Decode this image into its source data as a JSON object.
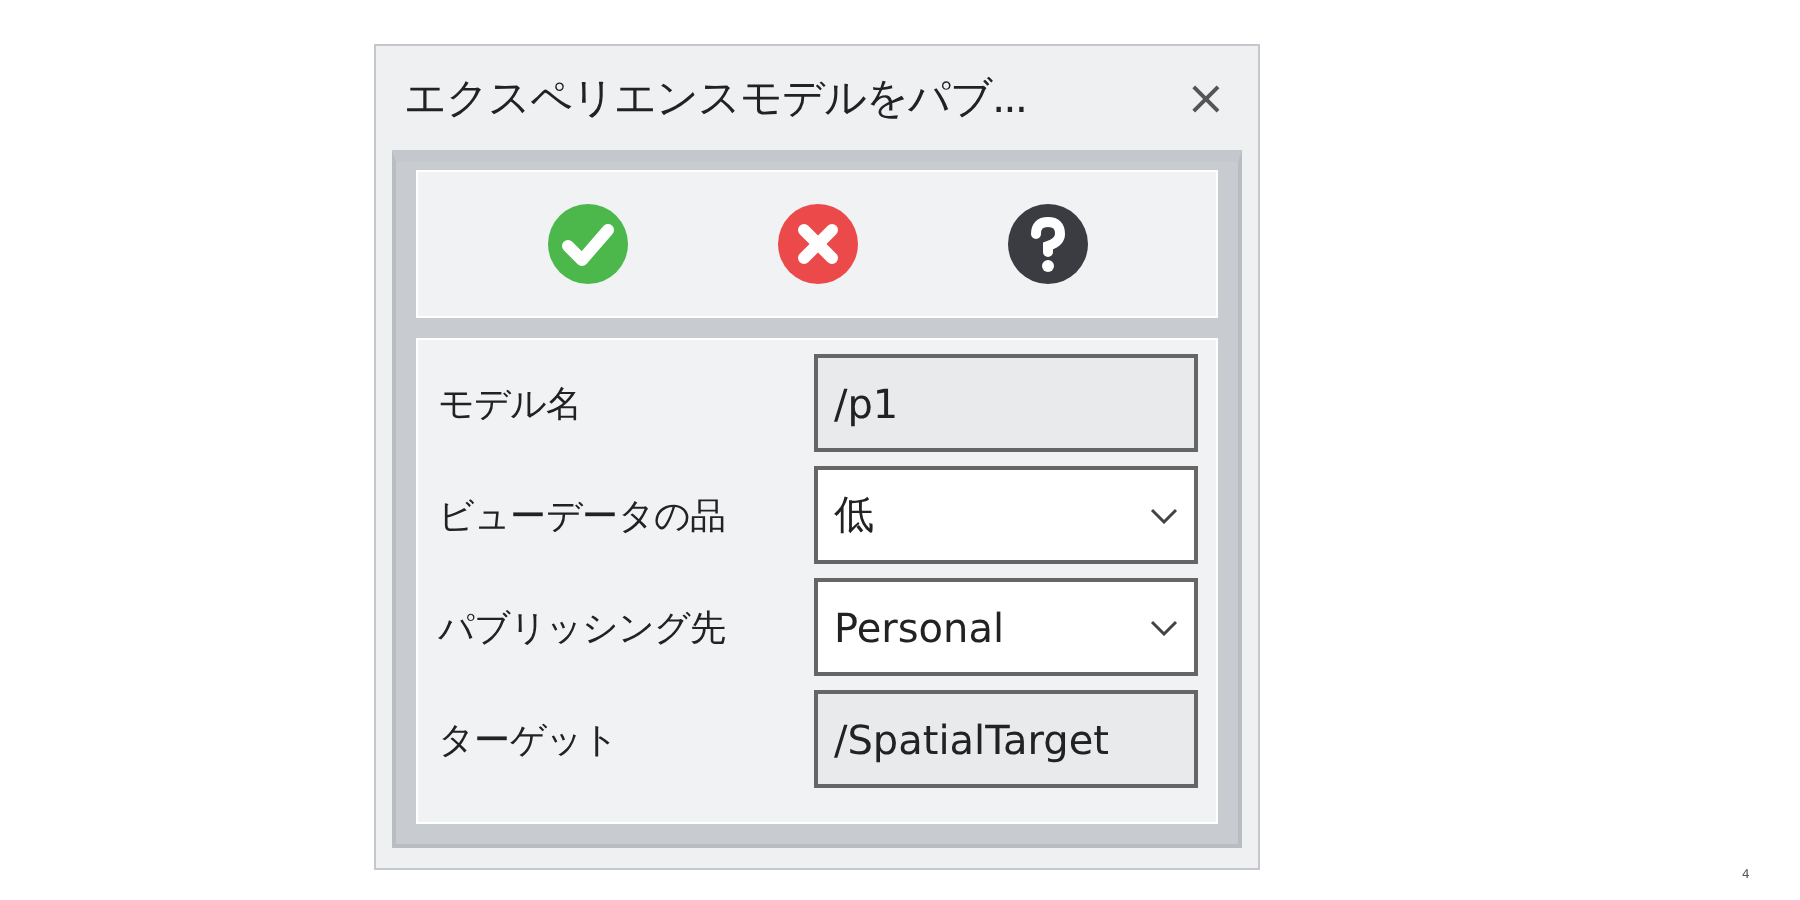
{
  "window": {
    "title": "エクスペリエンスモデルをパブ...",
    "close": "×"
  },
  "toolbar": [
    {
      "kind": "ok"
    },
    {
      "kind": "cancel"
    },
    {
      "kind": "help"
    }
  ],
  "fields": [
    {
      "label": "モデル名",
      "kind": "text",
      "value": "/p1"
    },
    {
      "label": "ビューデータの品",
      "kind": "dropdown",
      "value": "低"
    },
    {
      "label": "パブリッシング先",
      "kind": "dropdown",
      "value": "Personal"
    },
    {
      "label": "ターゲット",
      "kind": "text",
      "value": "/SpatialTarget"
    }
  ],
  "page_number": "4"
}
